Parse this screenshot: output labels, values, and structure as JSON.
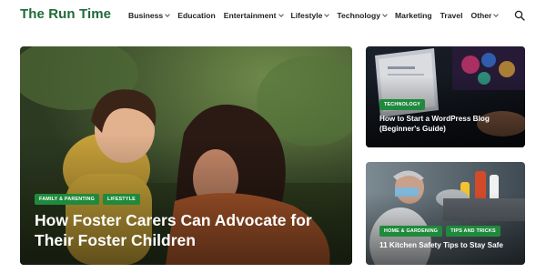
{
  "site": {
    "logo": "The Run Time"
  },
  "nav": {
    "items": [
      {
        "label": "Business",
        "has_dropdown": true
      },
      {
        "label": "Education",
        "has_dropdown": false
      },
      {
        "label": "Entertainment",
        "has_dropdown": true
      },
      {
        "label": "Lifestyle",
        "has_dropdown": true
      },
      {
        "label": "Technology",
        "has_dropdown": true
      },
      {
        "label": "Marketing",
        "has_dropdown": false
      },
      {
        "label": "Travel",
        "has_dropdown": false
      },
      {
        "label": "Other",
        "has_dropdown": true
      }
    ],
    "search_icon": "search-icon"
  },
  "featured": {
    "main": {
      "tags": [
        "FAMILY & PARENTING",
        "LIFESTYLE"
      ],
      "title": "How Foster Carers Can Advocate for Their Foster Children"
    },
    "side_top": {
      "tags": [
        "TECHNOLOGY"
      ],
      "title": "How to Start a WordPress Blog (Beginner's Guide)"
    },
    "side_bottom": {
      "tags": [
        "HOME & GARDENING",
        "TIPS AND TRICKS"
      ],
      "title": "11 Kitchen Safety Tips to Stay Safe"
    }
  },
  "colors": {
    "brand": "#1f6a3a",
    "tag": "#1f8a3c"
  }
}
